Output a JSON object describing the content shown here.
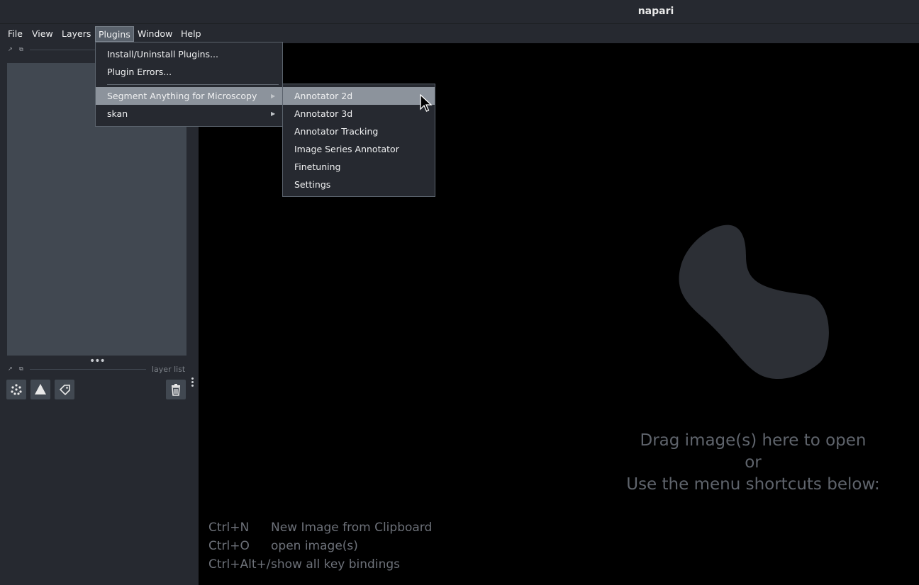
{
  "window": {
    "title": "napari"
  },
  "menubar": {
    "items": [
      {
        "label": "File"
      },
      {
        "label": "View"
      },
      {
        "label": "Layers"
      },
      {
        "label": "Plugins"
      },
      {
        "label": "Window"
      },
      {
        "label": "Help"
      }
    ],
    "active": "Plugins"
  },
  "plugins_menu": {
    "items": [
      {
        "label": "Install/Uninstall Plugins..."
      },
      {
        "label": "Plugin Errors..."
      },
      {
        "label": "Segment Anything for Microscopy",
        "submenu": true,
        "highlighted": true
      },
      {
        "label": "skan",
        "submenu": true
      }
    ]
  },
  "sam_submenu": {
    "items": [
      {
        "label": "Annotator 2d",
        "highlighted": true
      },
      {
        "label": "Annotator 3d"
      },
      {
        "label": "Annotator Tracking"
      },
      {
        "label": "Image Series Annotator"
      },
      {
        "label": "Finetuning"
      },
      {
        "label": "Settings"
      }
    ]
  },
  "left_panel": {
    "layer_list_label": "layer list",
    "buttons": [
      {
        "icon": "new-points-layer-icon"
      },
      {
        "icon": "new-shapes-layer-icon"
      },
      {
        "icon": "new-labels-layer-icon"
      },
      {
        "icon": "delete-layer-icon"
      }
    ]
  },
  "welcome": {
    "line1": "Drag image(s) here to open",
    "line2": "or",
    "line3": "Use the menu shortcuts below:",
    "shortcuts": [
      {
        "key": "Ctrl+N",
        "desc": "New Image from Clipboard"
      },
      {
        "key": "Ctrl+O",
        "desc": "open image(s)"
      },
      {
        "key": "Ctrl+Alt+/",
        "desc": "show all key bindings"
      }
    ]
  },
  "colors": {
    "background": "#262930",
    "panel": "#414851",
    "canvas": "#000000",
    "highlight": "#8c939c"
  }
}
